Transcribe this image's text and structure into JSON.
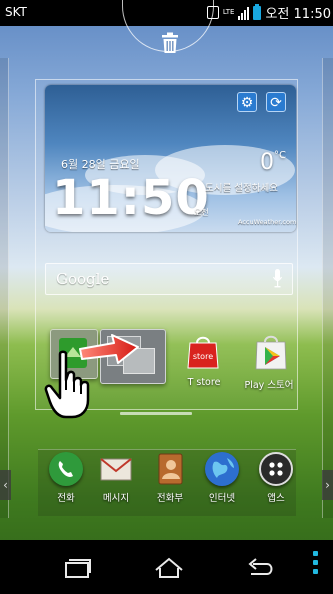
{
  "status_bar": {
    "carrier": "SKT",
    "network": "LTE",
    "time": "오전 11:50",
    "battery_color": "#19a8e0"
  },
  "edit_mode": {
    "remove_icon": "trash-icon"
  },
  "weather_widget": {
    "date": "6월 28일 금요일",
    "clock": "11:50",
    "ampm": "오전",
    "temperature": "0",
    "temp_unit": "°C",
    "location_prompt": "도시를 설정하세요",
    "provider": "AccuWeather.com",
    "settings_icon": "gear-icon",
    "refresh_icon": "refresh-icon"
  },
  "google_search": {
    "logo": "Google",
    "mic_icon": "microphone-icon"
  },
  "apps": [
    {
      "label": "T store",
      "icon": "tstore-icon",
      "color": "#d9231e"
    },
    {
      "label": "Play 스토어",
      "icon": "play-store-icon",
      "color": "#e8e8e8"
    }
  ],
  "gesture_hint": {
    "arrow_icon": "drag-arrow-icon",
    "hand_icon": "pointing-hand-icon"
  },
  "dock": [
    {
      "label": "전화",
      "icon": "phone-icon",
      "color": "#2f9a3b"
    },
    {
      "label": "메시지",
      "icon": "message-icon",
      "color": "#d8d4cc"
    },
    {
      "label": "전화부",
      "icon": "contacts-icon",
      "color": "#b86a2e"
    },
    {
      "label": "인터넷",
      "icon": "globe-icon",
      "color": "#2d6fcf"
    },
    {
      "label": "앱스",
      "icon": "apps-grid-icon",
      "color": "#2a2a2a"
    }
  ],
  "nav_bar": {
    "recent_icon": "recent-apps-icon",
    "home_icon": "home-icon",
    "back_icon": "back-icon",
    "menu_icon": "menu-icon",
    "menu_color": "#22b9e0"
  }
}
